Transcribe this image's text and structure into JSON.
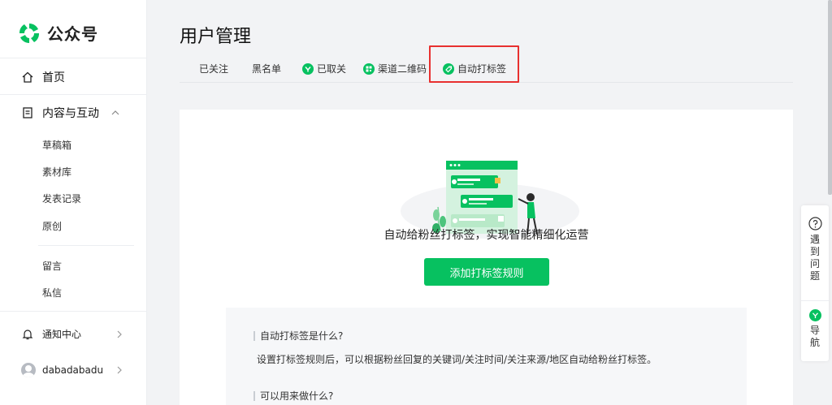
{
  "logo": {
    "text": "公众号"
  },
  "sidebar": {
    "home": "首页",
    "content": "内容与互动",
    "content_sub": [
      "草稿箱",
      "素材库",
      "发表记录",
      "原创"
    ],
    "msg_sub": [
      "留言",
      "私信"
    ],
    "notice": "通知中心",
    "user": "dabadabadu"
  },
  "page": {
    "title": "用户管理"
  },
  "tabs": [
    "已关注",
    "黑名单",
    "已取关",
    "渠道二维码",
    "自动打标签"
  ],
  "main": {
    "headline": "自动给粉丝打标签，实现智能精细化运营",
    "cta": "添加打标签规则",
    "faq": [
      {
        "q": "自动打标签是什么?",
        "a": "设置打标签规则后，可以根据粉丝回复的关键词/关注时间/关注来源/地区自动给粉丝打标签。"
      },
      {
        "q": "可以用来做什么?"
      }
    ]
  },
  "float": {
    "help": [
      "遇",
      "到",
      "问",
      "题"
    ],
    "guide": [
      "导",
      "航"
    ]
  },
  "colors": {
    "brand": "#07c160",
    "highlight": "#e8302f"
  }
}
